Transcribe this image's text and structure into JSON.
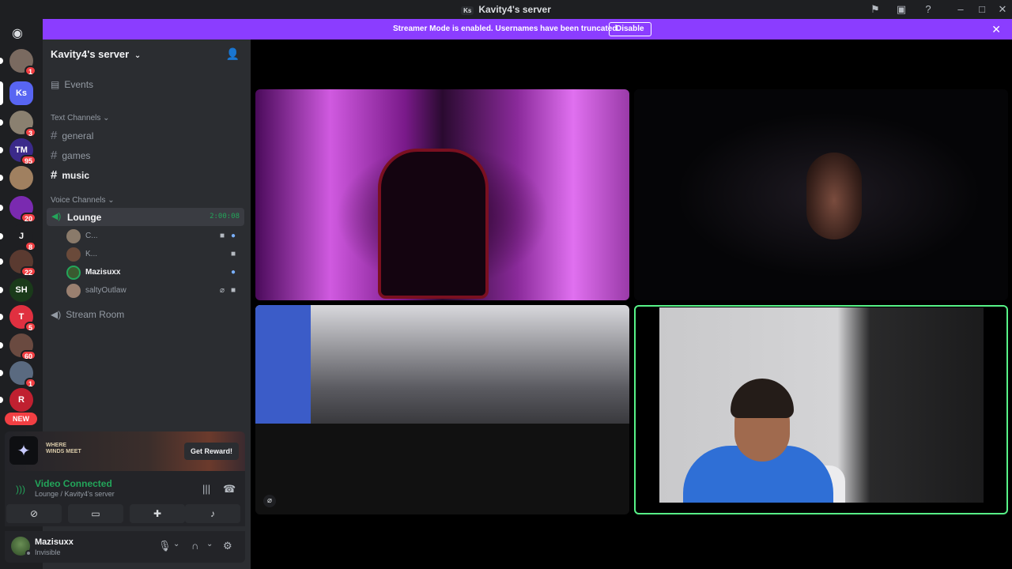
{
  "titlebar": {
    "server_initials": "Ks",
    "title": "Kavity4's server"
  },
  "banner": {
    "text": "Streamer Mode is enabled. Usernames have been truncated.",
    "button": "Disable"
  },
  "rail": {
    "servers": [
      {
        "initials": "",
        "badge": "1",
        "color": "#7a6a60"
      },
      {
        "initials": "Ks",
        "badge": "",
        "color": "#5865f2"
      },
      {
        "initials": "",
        "badge": "3",
        "color": "#8a8070"
      },
      {
        "initials": "TM",
        "badge": "95",
        "color": "#3b2a8a"
      },
      {
        "initials": "",
        "badge": "",
        "color": "#a08060"
      },
      {
        "initials": "",
        "badge": "20",
        "color": "#7a2ab0"
      },
      {
        "initials": "J",
        "badge": "8",
        "color": "#1e1f22"
      },
      {
        "initials": "",
        "badge": "22",
        "color": "#5a3a30"
      },
      {
        "initials": "SH",
        "badge": "",
        "color": "#1a3a1a"
      },
      {
        "initials": "T",
        "badge": "5",
        "color": "#e03040"
      },
      {
        "initials": "",
        "badge": "60",
        "color": "#6a4a40"
      },
      {
        "initials": "",
        "badge": "1",
        "color": "#5a6a80"
      },
      {
        "initials": "R",
        "badge": "",
        "color": "#c02030"
      }
    ],
    "new_label": "NEW"
  },
  "sidebar": {
    "server_name": "Kavity4's server",
    "events": "Events",
    "text_category": "Text Channels",
    "text_channels": [
      "general",
      "games",
      "music"
    ],
    "voice_category": "Voice Channels",
    "lounge": {
      "name": "Lounge",
      "time": "2:00:08"
    },
    "voice_users": [
      "C...",
      "K...",
      "Mazisuxx",
      "saltyOutlaw"
    ],
    "stream_room": "Stream Room"
  },
  "promo": {
    "wordmark_line1": "WHERE",
    "wordmark_line2": "WINDS MEET",
    "button": "Get Reward!"
  },
  "voice": {
    "status": "Video Connected",
    "location": "Lounge / Kavity4's server"
  },
  "user": {
    "name": "Mazisuxx",
    "status": "Invisible"
  },
  "colors": {
    "brand": "#8b3dff",
    "connected": "#23a55a",
    "speaking_border": "#57f287"
  }
}
